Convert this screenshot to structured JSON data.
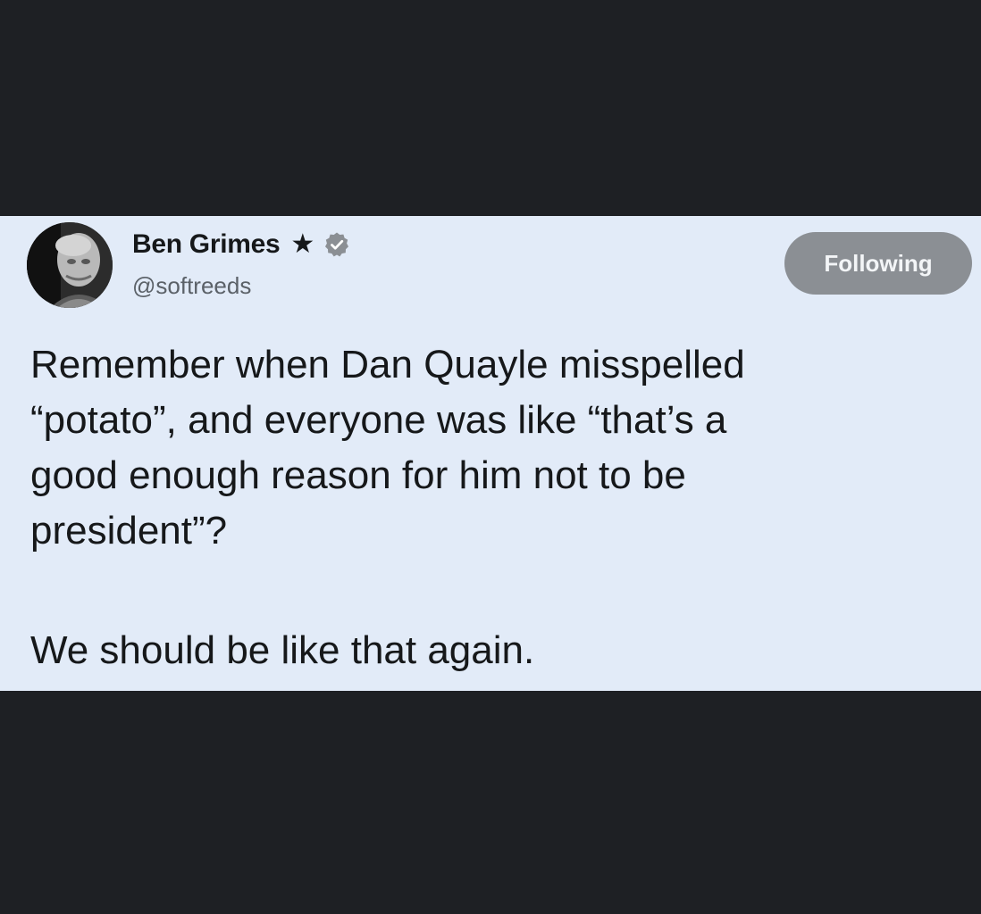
{
  "tweet": {
    "display_name": "Ben Grimes",
    "handle": "@softreeds",
    "follow_button_label": "Following",
    "body_paragraph_1": "Remember when Dan Quayle misspelled\n“potato”, and everyone was like “that’s a\ngood enough reason for him not to be\npresident”?",
    "body_paragraph_2": "We should be like that again.",
    "icons": {
      "star": "star-icon",
      "verified": "verified-badge-icon",
      "avatar": "user-avatar"
    }
  },
  "colors": {
    "background": "#1e2024",
    "card": "#e2ebf8",
    "text": "#16181a",
    "handle": "#5b6168",
    "button": "#8b8f94"
  }
}
